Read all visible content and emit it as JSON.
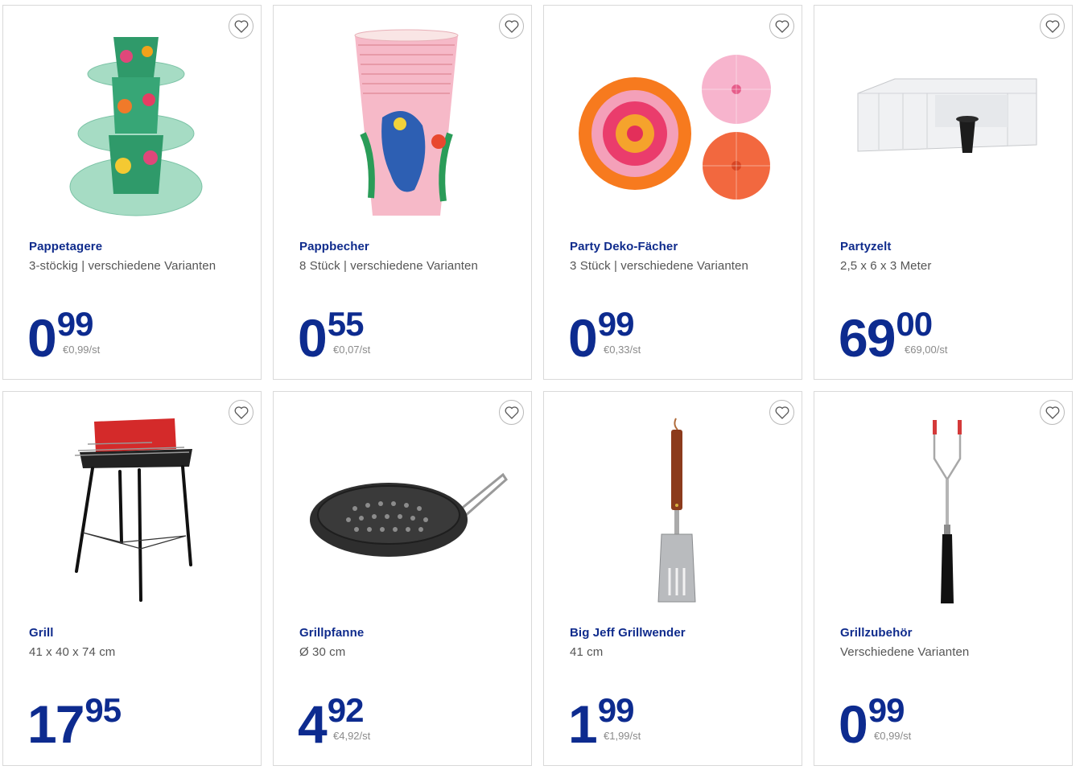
{
  "products": [
    {
      "title": "Pappetagere",
      "subtitle": "3-stöckig | verschiedene Varianten",
      "price_main": "0",
      "price_cents": "99",
      "unit_price": "€0,99/st",
      "icon": "cake-stand-image"
    },
    {
      "title": "Pappbecher",
      "subtitle": "8 Stück | verschiedene Varianten",
      "price_main": "0",
      "price_cents": "55",
      "unit_price": "€0,07/st",
      "icon": "paper-cups-image"
    },
    {
      "title": "Party Deko-Fächer",
      "subtitle": "3 Stück | verschiedene Varianten",
      "price_main": "0",
      "price_cents": "99",
      "unit_price": "€0,33/st",
      "icon": "paper-fans-image"
    },
    {
      "title": "Partyzelt",
      "subtitle": "2,5 x 6 x 3 Meter",
      "price_main": "69",
      "price_cents": "00",
      "unit_price": "€69,00/st",
      "icon": "party-tent-image"
    },
    {
      "title": "Grill",
      "subtitle": "41 x 40 x 74 cm",
      "price_main": "17",
      "price_cents": "95",
      "unit_price": "",
      "icon": "grill-image"
    },
    {
      "title": "Grillpfanne",
      "subtitle": "Ø 30 cm",
      "price_main": "4",
      "price_cents": "92",
      "unit_price": "€4,92/st",
      "icon": "grill-pan-image"
    },
    {
      "title": "Big Jeff Grillwender",
      "subtitle": "41 cm",
      "price_main": "1",
      "price_cents": "99",
      "unit_price": "€1,99/st",
      "icon": "spatula-image"
    },
    {
      "title": "Grillzubehör",
      "subtitle": "Verschiedene Varianten",
      "price_main": "0",
      "price_cents": "99",
      "unit_price": "€0,99/st",
      "icon": "roasting-fork-image"
    }
  ],
  "colors": {
    "brand_blue": "#0d2b8f",
    "title_blue": "#0f2b8c",
    "border": "#d9d9d9",
    "muted": "#8a8a8a"
  }
}
